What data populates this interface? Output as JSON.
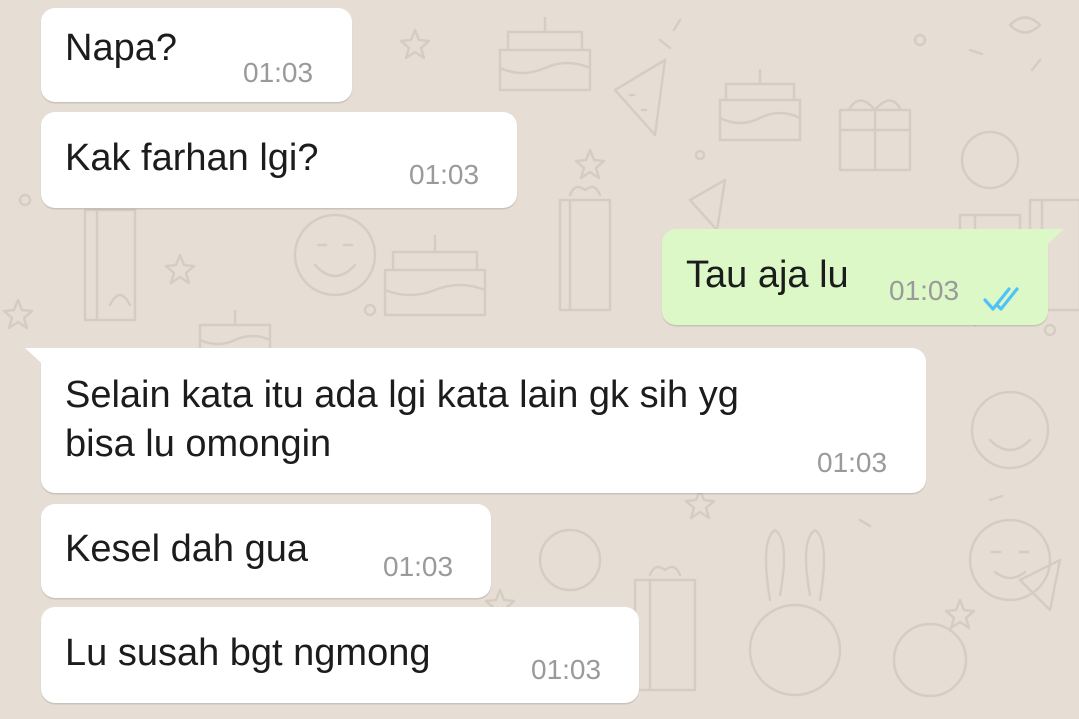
{
  "chat": {
    "messages": [
      {
        "text": "Napa?",
        "time": "01:03",
        "direction": "incoming"
      },
      {
        "text": "Kak farhan lgi?",
        "time": "01:03",
        "direction": "incoming"
      },
      {
        "text": "Tau aja lu",
        "time": "01:03",
        "direction": "outgoing",
        "status": "read",
        "status_icon": "double-check-icon",
        "status_color": "#4fc3f7"
      },
      {
        "line1": "Selain kata itu ada lgi kata lain gk sih yg",
        "line2": "bisa lu omongin",
        "time": "01:03",
        "direction": "incoming"
      },
      {
        "text": "Kesel dah gua",
        "time": "01:03",
        "direction": "incoming"
      },
      {
        "text": "Lu susah bgt ngmong",
        "time": "01:03",
        "direction": "incoming"
      }
    ]
  },
  "colors": {
    "background": "#e6ded5",
    "incoming_bubble": "#ffffff",
    "outgoing_bubble": "#dcf8c6",
    "timestamp": "#9a9a9a",
    "read_ticks": "#4fc3f7"
  }
}
